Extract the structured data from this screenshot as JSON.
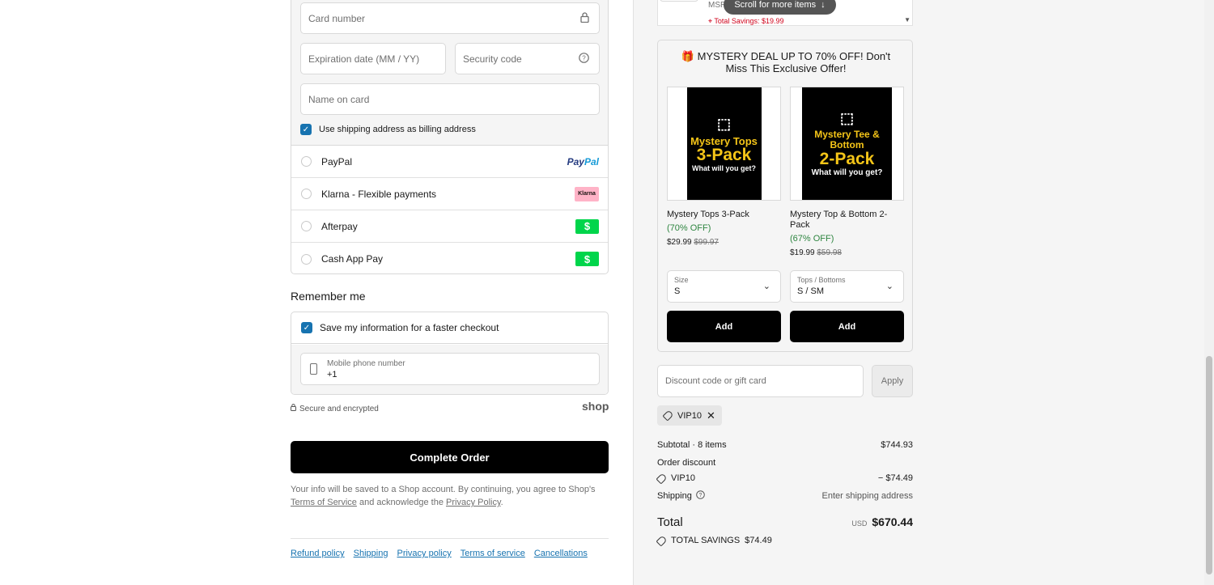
{
  "payment": {
    "card_number_placeholder": "Card number",
    "expiration_placeholder": "Expiration date (MM / YY)",
    "security_placeholder": "Security code",
    "name_placeholder": "Name on card",
    "billing_checkbox_label": "Use shipping address as billing address",
    "methods": [
      {
        "label": "PayPal",
        "logo": "PayPal"
      },
      {
        "label": "Klarna - Flexible payments",
        "logo": "Klarna"
      },
      {
        "label": "Afterpay",
        "logo": "$"
      },
      {
        "label": "Cash App Pay",
        "logo": "$"
      }
    ]
  },
  "remember": {
    "heading": "Remember me",
    "save_label": "Save my information for a faster checkout",
    "phone_label": "Mobile phone number",
    "phone_value": "+1"
  },
  "secure_text": "Secure and encrypted",
  "shop_logo": "shop",
  "complete_button": "Complete Order",
  "legal": {
    "prefix": "Your info will be saved to a Shop account. By continuing, you agree to Shop's",
    "terms": "Terms of Service",
    "middle": "and acknowledge the",
    "privacy": "Privacy Policy",
    "suffix": "."
  },
  "footer_links": [
    "Refund policy",
    "Shipping",
    "Privacy policy",
    "Terms of service",
    "Cancellations"
  ],
  "cart_snippet": {
    "msrp": "MSRP",
    "savings": "Total Savings: $19.99",
    "scroll_hint": "Scroll for more items"
  },
  "mystery": {
    "title": "🎁 MYSTERY DEAL UP TO 70% OFF! Don't Miss This Exclusive Offer!",
    "products": [
      {
        "img_line1": "Mystery Tops",
        "img_line2": "3-Pack",
        "img_line3": "What will you get?",
        "name": "Mystery Tops 3-Pack",
        "percent": "(70% OFF)",
        "price": "$29.99",
        "compare_price": "$99.97",
        "select_label": "Size",
        "select_value": "S",
        "button": "Add"
      },
      {
        "img_line1": "Mystery Tee & Bottom",
        "img_line2": "2-Pack",
        "img_line3": "What will you get?",
        "name": "Mystery Top & Bottom 2-Pack",
        "percent": "(67% OFF)",
        "price": "$19.99",
        "compare_price": "$59.98",
        "select_label": "Tops / Bottoms",
        "select_value": "S / SM",
        "button": "Add"
      }
    ]
  },
  "discount": {
    "placeholder": "Discount code or gift card",
    "apply": "Apply",
    "code": "VIP10"
  },
  "summary": {
    "subtotal_label": "Subtotal · 8 items",
    "subtotal_value": "$744.93",
    "order_discount_label": "Order discount",
    "discount_code": "VIP10",
    "discount_value": "− $74.49",
    "shipping_label": "Shipping",
    "shipping_value": "Enter shipping address",
    "total_label": "Total",
    "currency": "USD",
    "total_value": "$670.44",
    "total_savings_label": "TOTAL SAVINGS",
    "total_savings_value": "$74.49"
  },
  "colors": {
    "accent_blue": "#1773b0",
    "checkout_black": "#000000",
    "savings_red": "#d0021b",
    "discount_green": "#2e8540"
  }
}
